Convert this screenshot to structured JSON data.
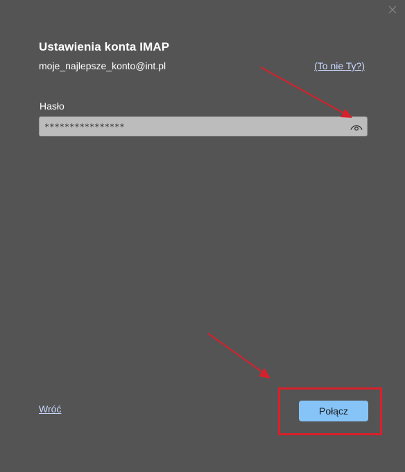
{
  "dialog": {
    "title": "Ustawienia konta IMAP",
    "email": "moje_najlepsze_konto@int.pl",
    "not_you_link": "(To nie Ty?)",
    "password_label": "Hasło",
    "password_value": "****************",
    "back_link": "Wróć",
    "connect_button": "Połącz"
  },
  "colors": {
    "background": "#545454",
    "accent_button": "#86c4f7",
    "link": "#c9d8ff",
    "annotation": "#d9202a"
  },
  "icons": {
    "close": "close-icon",
    "reveal_password": "eye-icon"
  }
}
